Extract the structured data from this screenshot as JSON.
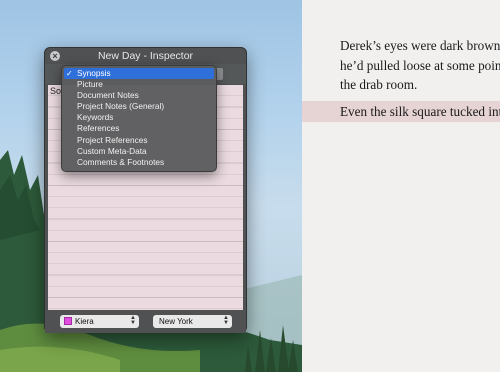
{
  "inspector": {
    "title": "New Day - Inspector",
    "close_icon": "close-icon",
    "notes_text": "So",
    "label_select": {
      "value": "Kiera",
      "swatch_color": "#e24ce0"
    },
    "status_select": {
      "value": "New York"
    }
  },
  "menu": {
    "items": [
      {
        "label": "Synopsis",
        "selected": true
      },
      {
        "label": "Picture"
      },
      {
        "label": "Document Notes"
      },
      {
        "label": "Project Notes (General)"
      },
      {
        "label": "Keywords"
      },
      {
        "label": "References"
      },
      {
        "label": "Project References"
      },
      {
        "label": "Custom Meta-Data"
      },
      {
        "label": "Comments & Footnotes"
      }
    ]
  },
  "document": {
    "line1": "Derek’s eyes were dark brown.",
    "line2": "he’d pulled loose at some point",
    "line3": "the drab room.",
    "line4": "Even the silk square tucked into"
  }
}
